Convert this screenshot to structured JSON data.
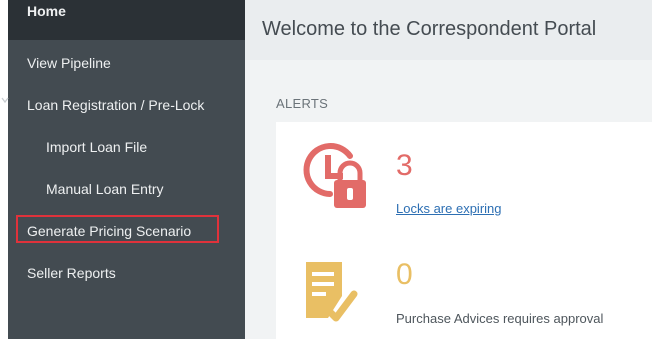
{
  "sidebar": {
    "items": [
      {
        "label": "Home"
      },
      {
        "label": "View Pipeline"
      },
      {
        "label": "Loan Registration / Pre-Lock"
      },
      {
        "label": "Import Loan File"
      },
      {
        "label": "Manual Loan Entry"
      },
      {
        "label": "Generate Pricing Scenario"
      },
      {
        "label": "Seller Reports"
      }
    ]
  },
  "header": {
    "title": "Welcome to the Correspondent Portal"
  },
  "main": {
    "alerts_label": "ALERTS",
    "alerts": [
      {
        "count": "3",
        "text": "Locks are expiring",
        "icon": "clock-lock-icon",
        "color": "#e26b68"
      },
      {
        "count": "0",
        "text": "Purchase Advices requires approval",
        "icon": "document-check-icon",
        "color": "#e9bf64"
      }
    ]
  },
  "colors": {
    "sidebar": "#434b51",
    "sidebar_active": "#2b3136",
    "highlight_border": "#e0323b",
    "link": "#2d6fb3"
  }
}
